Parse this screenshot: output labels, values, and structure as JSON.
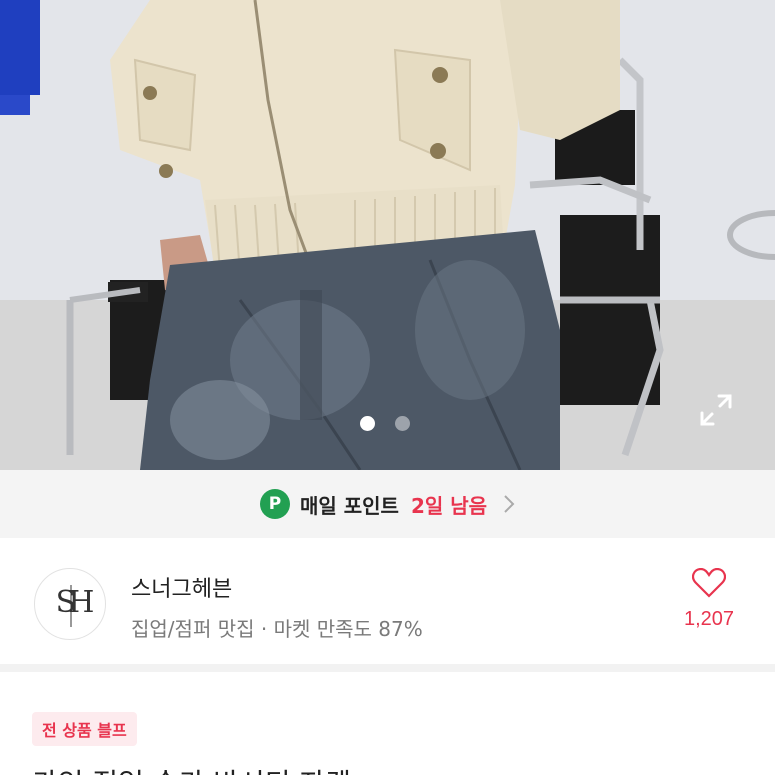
{
  "point_banner": {
    "badge": "P",
    "label": "매일 포인트",
    "remaining": "2일 남음"
  },
  "shop": {
    "logo_text": "SH",
    "name": "스너그헤븐",
    "description": "집업/점퍼 맛집 · 마켓 만족도 87%",
    "like_count": "1,207"
  },
  "product": {
    "badge": "전 상품 블프",
    "title": "카인 집업 숏카 바시티 자켓"
  },
  "gallery": {
    "total_slides": 2,
    "active_index": 0
  },
  "colors": {
    "accent": "#e8344e",
    "point_green": "#22a052",
    "badge_bg": "#fdebee"
  },
  "icons": {
    "expand": "expand-icon",
    "chevron": "chevron-right-icon",
    "like": "heart-icon"
  }
}
